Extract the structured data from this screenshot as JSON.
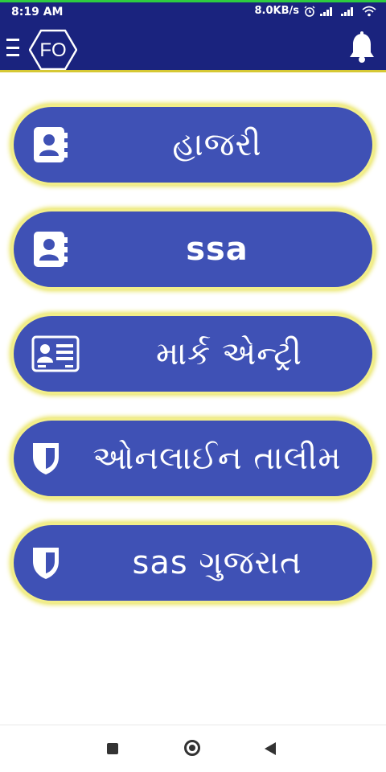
{
  "status_bar": {
    "time": "8:19 AM",
    "network_speed": "8.0KB/s",
    "icons": [
      "alarm-icon",
      "signal-icon",
      "signal-icon",
      "wifi-icon"
    ]
  },
  "app_bar": {
    "logo_text": "FO",
    "menu_icon": "hamburger-icon",
    "bell_icon": "bell-icon",
    "colors": {
      "bar": "#1a237e",
      "accent_line": "#d6c834",
      "status_line": "#2ecc40"
    }
  },
  "menu": {
    "button_color": "#3f51b5",
    "glow_color": "#e8e35b",
    "items": [
      {
        "label": "હાજરી",
        "icon": "contact-book-icon"
      },
      {
        "label": "ssa",
        "icon": "contact-book-icon"
      },
      {
        "label": "માર્ક એન્ટ્રી",
        "icon": "id-card-icon"
      },
      {
        "label": "ઓનલાઈન તાલીમ",
        "icon": "shield-icon"
      },
      {
        "label": "sas ગુજરાત",
        "icon": "shield-icon"
      }
    ]
  },
  "nav_bar": {
    "icons": [
      "recent-apps-icon",
      "home-icon",
      "back-icon"
    ]
  }
}
